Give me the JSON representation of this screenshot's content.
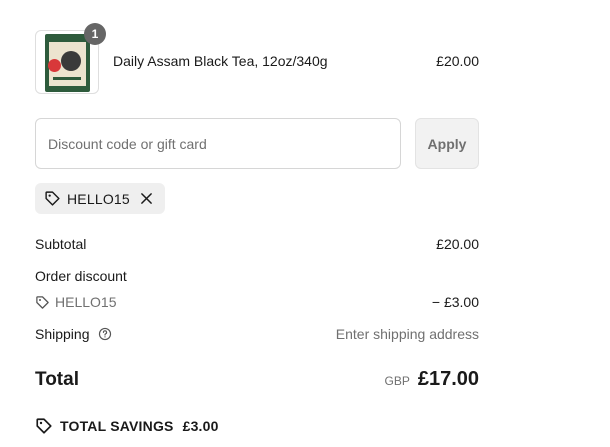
{
  "line_item": {
    "quantity": "1",
    "name": "Daily Assam Black Tea, 12oz/340g",
    "price": "£20.00"
  },
  "discount": {
    "placeholder": "Discount code or gift card",
    "apply_label": "Apply",
    "applied_code": "HELLO15"
  },
  "summary": {
    "subtotal_label": "Subtotal",
    "subtotal_value": "£20.00",
    "order_discount_label": "Order discount",
    "discount_code": "HELLO15",
    "discount_value": "− £3.00",
    "shipping_label": "Shipping",
    "shipping_value": "Enter shipping address",
    "total_label": "Total",
    "currency": "GBP",
    "total_value": "£17.00",
    "savings_label": "TOTAL SAVINGS",
    "savings_value": "£3.00"
  },
  "icons": {
    "tag": "tag-icon",
    "close": "close-icon",
    "help": "help-circle-icon",
    "savings": "savings-tag-icon"
  },
  "colors": {
    "text": "#1a1a1a",
    "muted": "#707070",
    "chip_bg": "#efefef",
    "badge_bg": "#666666"
  }
}
